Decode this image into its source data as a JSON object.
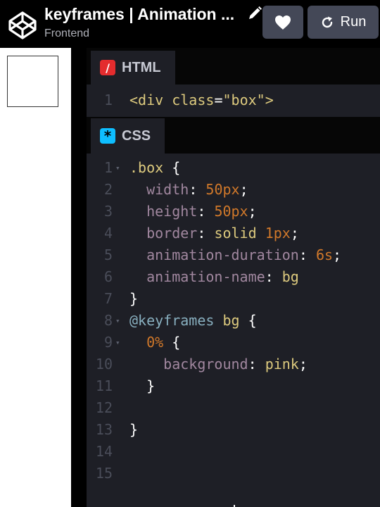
{
  "header": {
    "title": "keyframes | Animation ...",
    "subtitle": "Frontend",
    "heart_icon": "heart-icon",
    "run_label": "Run",
    "run_icon": "rerun-icon"
  },
  "html_editor": {
    "tab_label": "HTML",
    "tab_icon_glyph": "/",
    "tab_color": "#e42c2e",
    "lines": [
      {
        "n": "1",
        "tokens": [
          [
            "c-tag",
            "<div "
          ],
          [
            "c-attr",
            "class"
          ],
          [
            "c-punc",
            "="
          ],
          [
            "c-val",
            "\"box\""
          ],
          [
            "c-tag",
            ">"
          ]
        ]
      }
    ]
  },
  "css_editor": {
    "tab_label": "CSS",
    "tab_icon_glyph": "*",
    "tab_color": "#0ebeff",
    "lines": [
      {
        "n": "1",
        "fold": true,
        "tokens": [
          [
            "c-sel",
            ".box"
          ],
          [
            "c-punc",
            " {"
          ]
        ]
      },
      {
        "n": "2",
        "tokens": [
          [
            "c-punc",
            "  "
          ],
          [
            "c-prop",
            "width"
          ],
          [
            "c-punc",
            ": "
          ],
          [
            "c-num",
            "50px"
          ],
          [
            "c-punc",
            ";"
          ]
        ]
      },
      {
        "n": "3",
        "tokens": [
          [
            "c-punc",
            "  "
          ],
          [
            "c-prop",
            "height"
          ],
          [
            "c-punc",
            ": "
          ],
          [
            "c-num",
            "50px"
          ],
          [
            "c-punc",
            ";"
          ]
        ]
      },
      {
        "n": "4",
        "tokens": [
          [
            "c-punc",
            "  "
          ],
          [
            "c-prop",
            "border"
          ],
          [
            "c-punc",
            ": "
          ],
          [
            "c-val",
            "solid"
          ],
          [
            "c-punc",
            " "
          ],
          [
            "c-num",
            "1px"
          ],
          [
            "c-punc",
            ";"
          ]
        ]
      },
      {
        "n": "5",
        "tokens": [
          [
            "c-punc",
            "  "
          ],
          [
            "c-prop",
            "animation-duration"
          ],
          [
            "c-punc",
            ": "
          ],
          [
            "c-num",
            "6s"
          ],
          [
            "c-punc",
            ";"
          ]
        ]
      },
      {
        "n": "6",
        "tokens": [
          [
            "c-punc",
            "  "
          ],
          [
            "c-prop",
            "animation-name"
          ],
          [
            "c-punc",
            ": "
          ],
          [
            "c-val",
            "bg"
          ]
        ]
      },
      {
        "n": "7",
        "tokens": [
          [
            "c-punc",
            "}"
          ]
        ]
      },
      {
        "n": "8",
        "fold": true,
        "tokens": [
          [
            "c-at",
            "@keyframes"
          ],
          [
            "c-punc",
            " "
          ],
          [
            "c-val",
            "bg"
          ],
          [
            "c-punc",
            " {"
          ]
        ]
      },
      {
        "n": "9",
        "fold": true,
        "tokens": [
          [
            "c-punc",
            "  "
          ],
          [
            "c-num",
            "0%"
          ],
          [
            "c-punc",
            " {"
          ]
        ]
      },
      {
        "n": "10",
        "tokens": [
          [
            "c-punc",
            "    "
          ],
          [
            "c-prop",
            "background"
          ],
          [
            "c-punc",
            ": "
          ],
          [
            "c-val",
            "pink"
          ],
          [
            "c-punc",
            ";"
          ]
        ]
      },
      {
        "n": "11",
        "tokens": [
          [
            "c-punc",
            "  }"
          ]
        ]
      },
      {
        "n": "12",
        "tokens": []
      },
      {
        "n": "13",
        "tokens": [
          [
            "c-punc",
            "}"
          ]
        ]
      },
      {
        "n": "14",
        "tokens": []
      },
      {
        "n": "15",
        "tokens": []
      }
    ]
  }
}
